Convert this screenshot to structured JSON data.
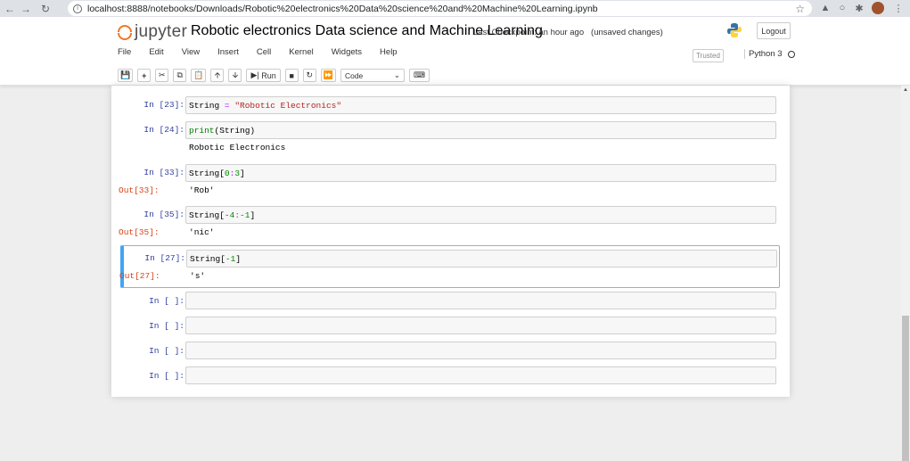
{
  "browser": {
    "url": "localhost:8888/notebooks/Downloads/Robotic%20electronics%20Data%20science%20and%20Machine%20Learning.ipynb"
  },
  "header": {
    "logo_text": "jupyter",
    "notebook_title": "Robotic electronics Data science and Machine Learning",
    "checkpoint": "Last Checkpoint: an hour ago",
    "unsaved": "(unsaved changes)",
    "logout_label": "Logout",
    "trusted_label": "Trusted",
    "kernel_label": "Python 3"
  },
  "menu": [
    "File",
    "Edit",
    "View",
    "Insert",
    "Cell",
    "Kernel",
    "Widgets",
    "Help"
  ],
  "toolbar": {
    "run_label": "Run",
    "cell_type": "Code"
  },
  "cells": [
    {
      "prompt": "In [23]:",
      "code_parts": [
        "String",
        " = ",
        "\"Robotic Electronics\""
      ],
      "output_prompt": "",
      "output": "",
      "stream": ""
    },
    {
      "prompt": "In [24]:",
      "code_parts": [
        "print",
        "(String)"
      ],
      "output_prompt": "",
      "output": "",
      "stream": "Robotic Electronics"
    },
    {
      "prompt": "In [33]:",
      "code_parts": [
        "String",
        "[",
        "0",
        ":",
        "3",
        "]"
      ],
      "output_prompt": "Out[33]:",
      "output": "'Rob'",
      "stream": ""
    },
    {
      "prompt": "In [35]:",
      "code_parts": [
        "String",
        "[",
        "-4",
        ":",
        "-1",
        "]"
      ],
      "output_prompt": "Out[35]:",
      "output": "'nic'",
      "stream": ""
    },
    {
      "prompt": "In [27]:",
      "code_parts": [
        "String",
        "[",
        "-1",
        "]"
      ],
      "output_prompt": "Out[27]:",
      "output": "'s'",
      "stream": ""
    },
    {
      "prompt": "In [ ]:"
    },
    {
      "prompt": "In [ ]:"
    },
    {
      "prompt": "In [ ]:"
    },
    {
      "prompt": "In [ ]:"
    }
  ]
}
